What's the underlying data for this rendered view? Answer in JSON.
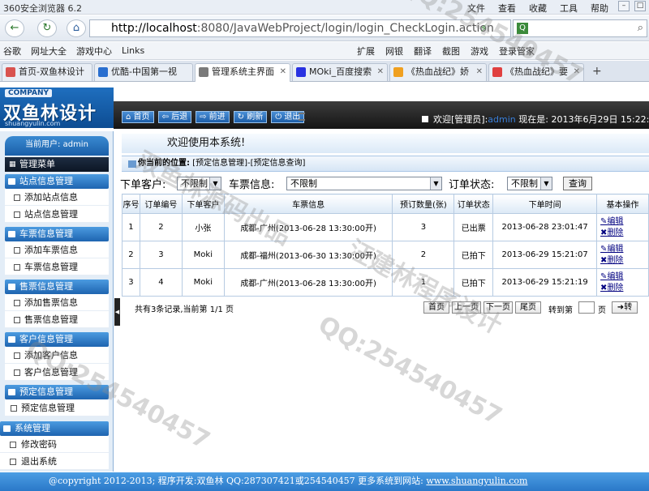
{
  "browser": {
    "title": "360安全浏览器 6.2",
    "menus": [
      "文件",
      "查看",
      "收藏",
      "工具",
      "帮助"
    ],
    "url_host": "http://localhost",
    "url_rest": ":8080/JavaWebProject/login/login_CheckLogin.action",
    "bookmarks": [
      "谷歌",
      "网址大全",
      "游戏中心",
      "Links"
    ],
    "toolbar_right": [
      "扩展",
      "网银",
      "翻译",
      "截图",
      "游戏",
      "登录管家"
    ],
    "tabs": [
      {
        "label": "首页-双鱼林设计",
        "color": "#d9534f"
      },
      {
        "label": "优酷-中国第一视",
        "color": "#2a6fcf"
      },
      {
        "label": "管理系统主界面",
        "color": "#7a7a7a",
        "active": true
      },
      {
        "label": "MOki_百度搜索",
        "color": "#2932e1"
      },
      {
        "label": "《热血战纪》娇",
        "color": "#f0a020"
      },
      {
        "label": "《热血战纪》要",
        "color": "#e04040"
      }
    ]
  },
  "app": {
    "logo_company": "COMPANY",
    "logo_name": "双鱼林设计",
    "logo_url": "shuangyulin.com",
    "nav_buttons": [
      "首页",
      "后退",
      "前进",
      "刷新",
      "退出"
    ],
    "welcome_prefix": "欢迎[管理员]:",
    "welcome_user": "admin",
    "welcome_time": "现在是: 2013年6月29日 15:22:30"
  },
  "sidebar": {
    "current_user": "当前用户: admin",
    "menu_title": "管理菜单",
    "sections": [
      {
        "label": "站点信息管理",
        "items": [
          "添加站点信息",
          "站点信息管理"
        ]
      },
      {
        "label": "车票信息管理",
        "items": [
          "添加车票信息",
          "车票信息管理"
        ]
      },
      {
        "label": "售票信息管理",
        "items": [
          "添加售票信息",
          "售票信息管理"
        ]
      },
      {
        "label": "客户信息管理",
        "items": [
          "添加客户信息",
          "客户信息管理"
        ]
      },
      {
        "label": "预定信息管理",
        "items": [
          "预定信息管理"
        ]
      },
      {
        "label": "系统管理",
        "items": [
          "修改密码",
          "退出系统"
        ]
      }
    ]
  },
  "main": {
    "banner": "欢迎使用本系统!",
    "position_label": "你当前的位置:",
    "position_path": "[预定信息管理]-[预定信息查询]",
    "filter": {
      "customer_label": "下单客户:",
      "customer_value": "不限制",
      "ticket_label": "车票信息:",
      "ticket_value": "不限制",
      "status_label": "订单状态:",
      "status_value": "不限制",
      "query_button": "查询"
    },
    "table": {
      "headers": [
        "序号",
        "订单编号",
        "下单客户",
        "车票信息",
        "预订数量(张)",
        "订单状态",
        "下单时间",
        "基本操作"
      ],
      "rows": [
        [
          "1",
          "2",
          "小张",
          "成都-广州(2013-06-28 13:30:00开)",
          "3",
          "已出票",
          "2013-06-28 23:01:47"
        ],
        [
          "2",
          "3",
          "Moki",
          "成都-福州(2013-06-30 13:30:00开)",
          "2",
          "已拍下",
          "2013-06-29 15:21:07"
        ],
        [
          "3",
          "4",
          "Moki",
          "成都-广州(2013-06-28 13:30:00开)",
          "1",
          "已拍下",
          "2013-06-29 15:21:19"
        ]
      ],
      "edit_label": "编辑",
      "delete_label": "删除"
    },
    "pager": {
      "info": "共有3条记录,当前第 1/1 页",
      "first": "首页",
      "prev": "上一页",
      "next": "下一页",
      "last": "尾页",
      "goto_label": "转到第",
      "page_unit": "页",
      "go": "转"
    }
  },
  "footer": {
    "text": "@copyright 2012-2013; 程序开发:双鱼林  QQ:287307421或254540457  更多系统到网站:",
    "site": "www.shuangyulin.com"
  },
  "watermarks": [
    "QQ:254540457",
    "双鱼林源码出品",
    "汪建林程序设计"
  ]
}
